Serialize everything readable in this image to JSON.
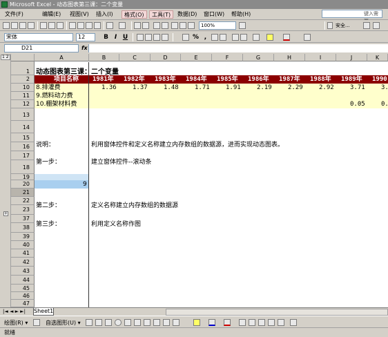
{
  "window": {
    "title": "Microsoft Excel - 动态图表第三课：二个变量"
  },
  "menu": {
    "items": [
      "文件(F)",
      "编辑(E)",
      "视图(V)",
      "插入(I)",
      "格式(O)",
      "工具(T)",
      "数据(D)",
      "窗口(W)",
      "帮助(H)"
    ],
    "help_placeholder": "键入需要"
  },
  "toolbar": {
    "zoom": "100%",
    "safe_label": "安全...",
    "font_name": "宋体",
    "font_size": "12",
    "bold": "B",
    "italic": "I",
    "underline": "U",
    "percent": "%",
    "comma": ","
  },
  "formula": {
    "cell_ref": "D21",
    "fx": "fx",
    "value": ""
  },
  "outline": {
    "levels": "1 2",
    "expand": "+"
  },
  "columns": [
    "A",
    "B",
    "C",
    "D",
    "E",
    "F",
    "G",
    "H",
    "I",
    "J",
    "K"
  ],
  "rows": [
    "1",
    "2",
    "10",
    "11",
    "12",
    "13",
    "14",
    "15",
    "16",
    "17",
    "18",
    "19",
    "20",
    "21",
    "22",
    "23",
    "37",
    "38",
    "39",
    "40",
    "41",
    "42",
    "43",
    "44",
    "45",
    "46",
    "47"
  ],
  "sheet": {
    "title": "动态图表第三课：二个变量",
    "header_label": "项目名称",
    "years": [
      "1981年",
      "1982年",
      "1983年",
      "1984年",
      "1985年",
      "1986年",
      "1987年",
      "1988年",
      "1989年",
      "1990"
    ],
    "items": [
      {
        "name": "8.排灌费",
        "values": [
          "1.36",
          "1.37",
          "1.48",
          "1.71",
          "1.91",
          "2.19",
          "2.29",
          "2.92",
          "3.71",
          "3."
        ]
      },
      {
        "name": "9.燃料动力费",
        "values": [
          "",
          "",
          "",
          "",
          "",
          "",
          "",
          "",
          "",
          ""
        ]
      },
      {
        "name": "10.棚架材料费",
        "values": [
          "",
          "",
          "",
          "",
          "",
          "",
          "",
          "",
          "0.05",
          "0."
        ]
      }
    ],
    "notes": [
      {
        "label": "说明：",
        "text": "利用窗体控件和定义名称建立内存数组的数据源，进而实现动态图表。"
      },
      {
        "label": "第一步：",
        "text": "建立窗体控件--滚动条"
      },
      {
        "label": "第二步：",
        "text": "定义名称建立内存数组的数据源"
      },
      {
        "label": "第三步：",
        "text": "利用定义名称作图"
      }
    ],
    "a21_value": "9"
  },
  "tabs": {
    "nav": "|◄ ◄ ► ►|",
    "sheets": [
      "Sheet1"
    ]
  },
  "drawing": {
    "draw_label": "绘图(R) ▾",
    "autoshape_label": "自选图形(U) ▾"
  },
  "status": {
    "text": "就绪"
  },
  "colors": {
    "header_band": "#8b0000",
    "data_band": "#ffffcc",
    "selection": "#a9cfef"
  }
}
